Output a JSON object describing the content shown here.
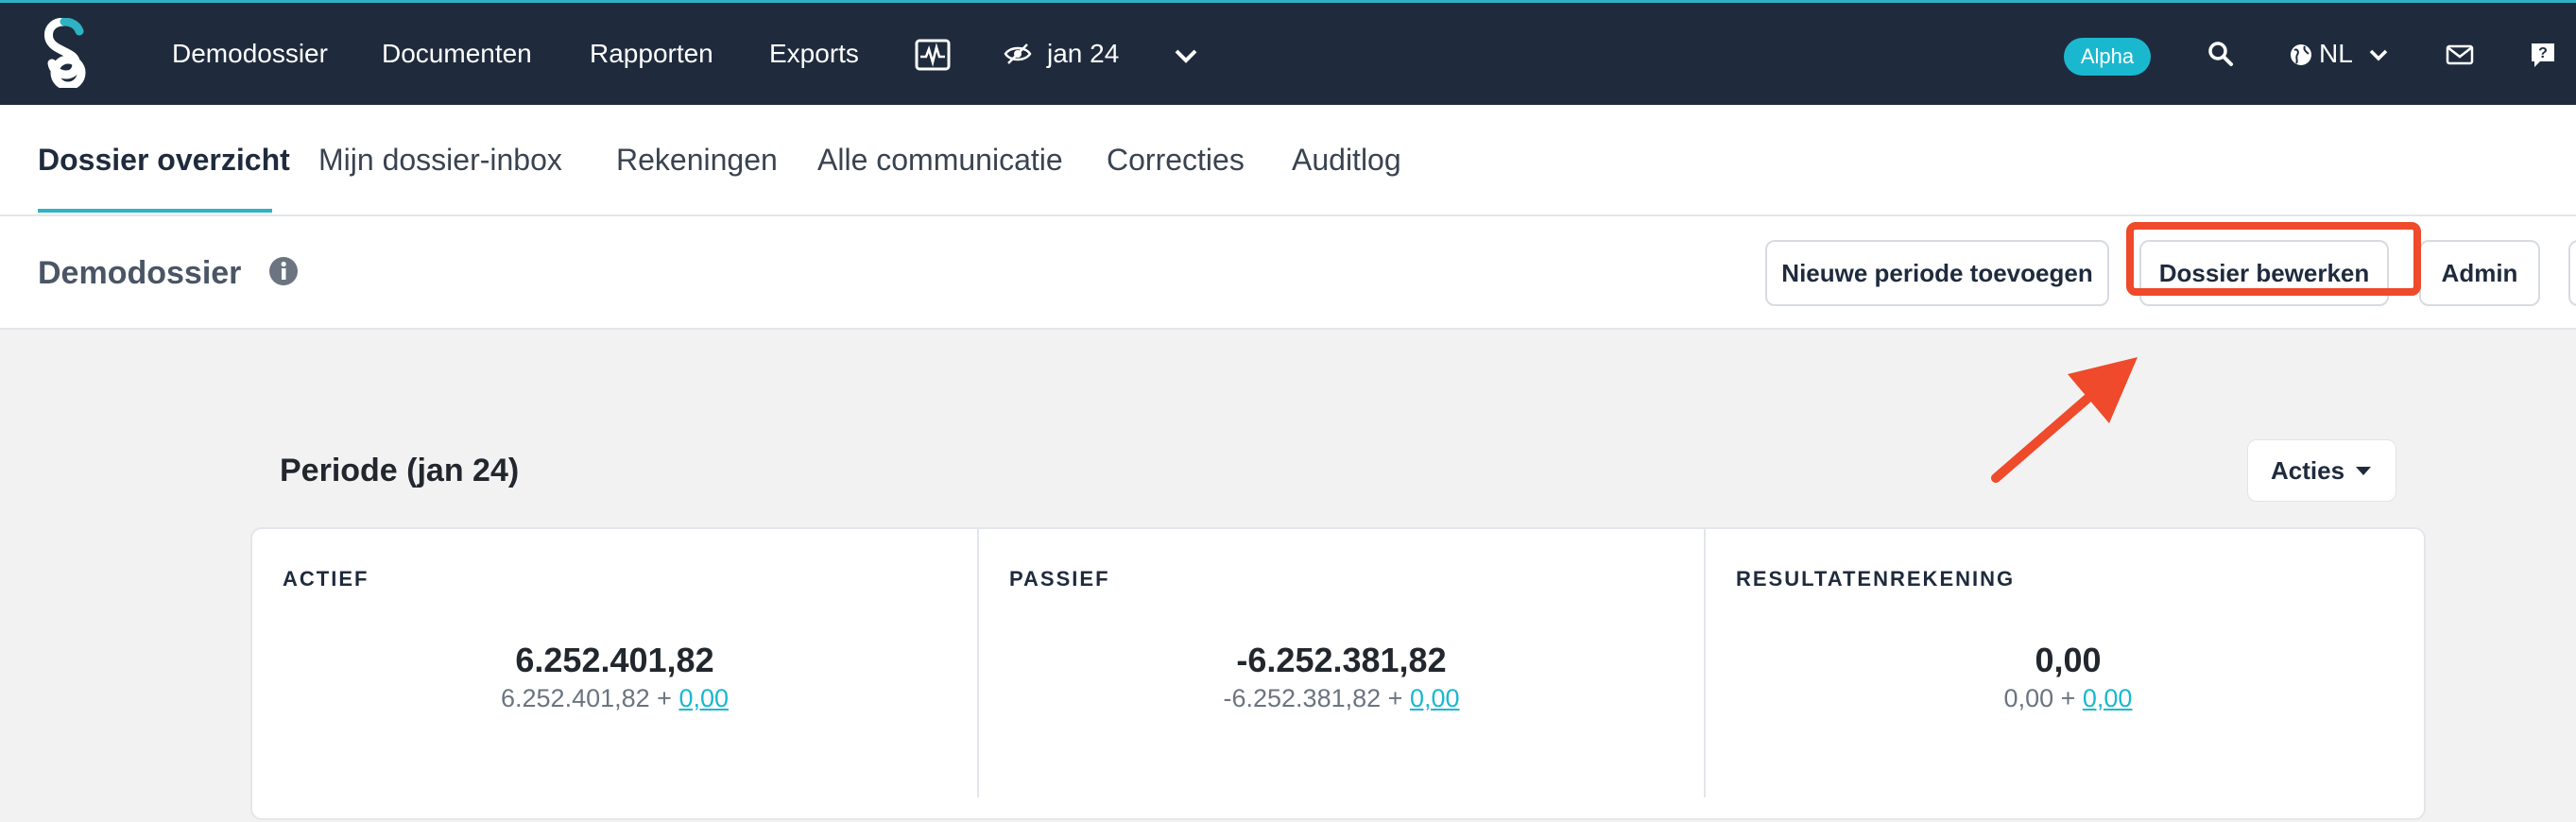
{
  "topnav": {
    "items": [
      "Demodossier",
      "Documenten",
      "Rapporten",
      "Exports"
    ],
    "period": "jan 24",
    "badge": "Alpha",
    "language": "NL",
    "icons": [
      "activity-monitor-icon",
      "eye-off-icon",
      "chevron-down-icon",
      "search-icon",
      "globe-icon",
      "mail-icon",
      "help-icon"
    ]
  },
  "subnav": {
    "tabs": [
      "Dossier overzicht",
      "Mijn dossier-inbox",
      "Rekeningen",
      "Alle communicatie",
      "Correcties",
      "Auditlog"
    ],
    "active_index": 0
  },
  "header": {
    "title": "Demodossier",
    "buttons": {
      "new_period": "Nieuwe periode toevoegen",
      "edit_dossier": "Dossier bewerken",
      "admin": "Admin"
    }
  },
  "period": {
    "title": "Periode (jan 24)",
    "actions_label": "Acties"
  },
  "cards": [
    {
      "label": "ACTIEF",
      "value": "6.252.401,82",
      "sub_base": "6.252.401,82 +",
      "sub_link": "0,00"
    },
    {
      "label": "PASSIEF",
      "value": "-6.252.381,82",
      "sub_base": "-6.252.381,82 +",
      "sub_link": "0,00"
    },
    {
      "label": "RESULTATENREKENING",
      "value": "0,00",
      "sub_base": "0,00 +",
      "sub_link": "0,00"
    }
  ],
  "colors": {
    "topbar": "#1f2b3d",
    "accent": "#2fb2c4",
    "highlight": "#ee4a2b"
  }
}
